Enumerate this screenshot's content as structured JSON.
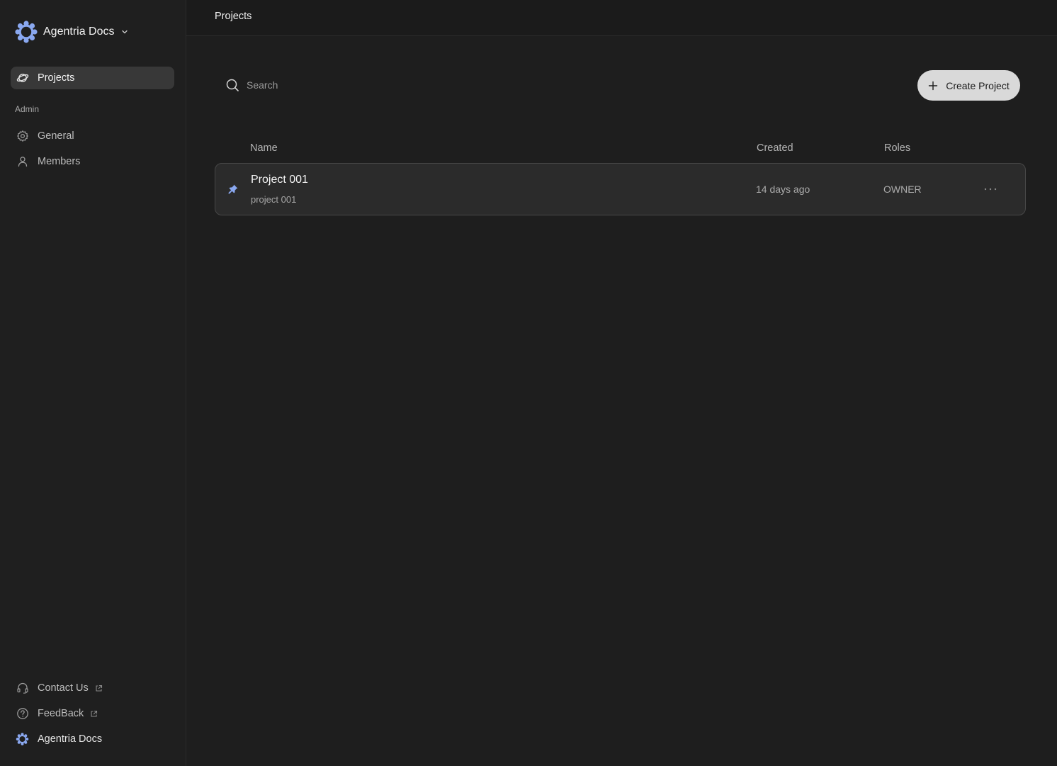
{
  "sidebar": {
    "workspace_name": "Agentria Docs",
    "nav": [
      {
        "label": "Projects",
        "icon": "planet-icon",
        "active": true
      }
    ],
    "admin_label": "Admin",
    "admin_items": [
      {
        "label": "General",
        "icon": "gear-icon"
      },
      {
        "label": "Members",
        "icon": "user-icon"
      }
    ],
    "footer_items": [
      {
        "label": "Contact Us",
        "icon": "headset-icon",
        "external": true
      },
      {
        "label": "FeedBack",
        "icon": "help-circle-icon",
        "external": true
      },
      {
        "label": "Agentria Docs",
        "icon": "agentria-logo-icon",
        "external": false
      }
    ]
  },
  "header": {
    "title": "Projects"
  },
  "toolbar": {
    "search_placeholder": "Search",
    "create_label": "Create Project"
  },
  "table": {
    "columns": [
      "Name",
      "Created",
      "Roles"
    ],
    "rows": [
      {
        "name": "Project 001",
        "slug": "project 001",
        "created": "14 days ago",
        "role": "OWNER",
        "pinned": true
      }
    ]
  },
  "colors": {
    "background": "#1e1e1e",
    "sidebar_active": "#383838",
    "accent": "#8aa8f0",
    "button": "#d9d9d9"
  }
}
